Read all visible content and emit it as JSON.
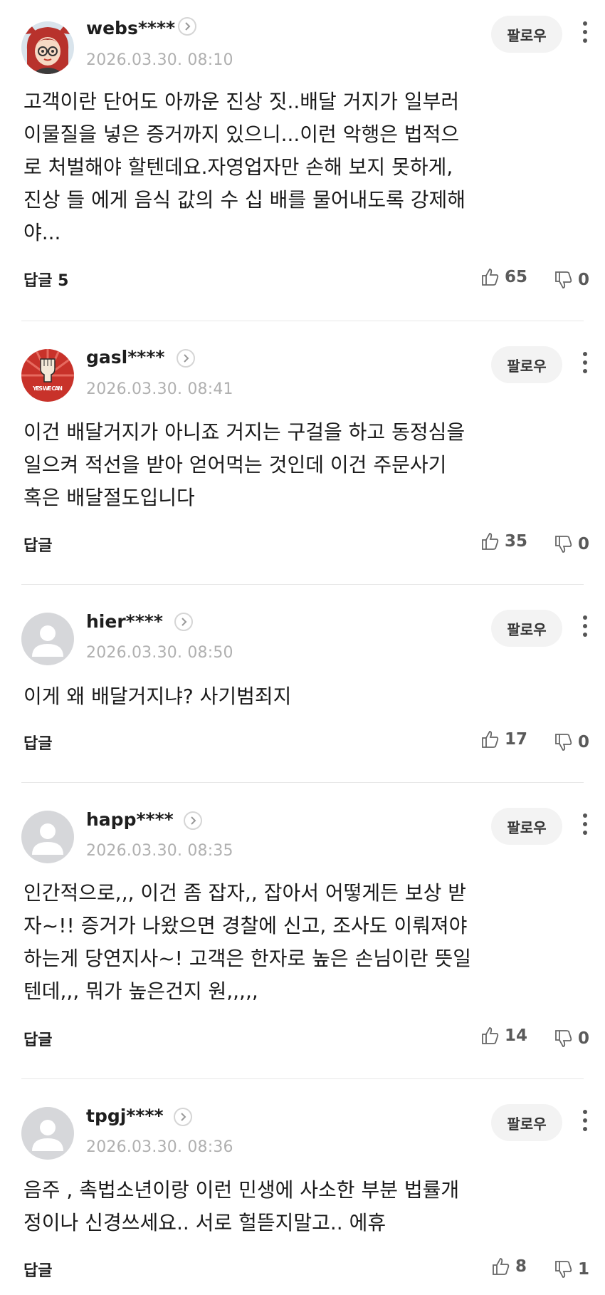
{
  "comments": [
    {
      "username": "webs****",
      "date": "2026.03.30. 08:10",
      "follow": "팔로우",
      "text": "고객이란 단어도 아까운 진상 짓..배달 거지가 일부러\n이물질을 넣은 증거까지 있으니...이런 악행은 법적으\n로 처벌해야 할텐데요.자영업자만 손해 보지 못하게,\n진상 들 에게 음식 값의 수 십 배를 물어내도록 강제해\n야...",
      "reply": "답글 5",
      "likes": "65",
      "dislikes": "0",
      "avatar": "character-icon"
    },
    {
      "username": "gasl****",
      "date": "2026.03.30. 08:41",
      "follow": "팔로우",
      "text": "이건 배달거지가 아니죠 거지는 구걸을 하고 동정심을\n일으켜 적선을 받아 얻어먹는 것인데 이건 주문사기\n혹은 배달절도입니다",
      "reply": "답글",
      "likes": "35",
      "dislikes": "0",
      "avatar": "fist-icon",
      "avatar_text": "YES WE CAN"
    },
    {
      "username": "hier****",
      "date": "2026.03.30. 08:50",
      "follow": "팔로우",
      "text": "이게 왜 배달거지냐? 사기범죄지",
      "reply": "답글",
      "likes": "17",
      "dislikes": "0",
      "avatar": "default-user-icon"
    },
    {
      "username": "happ****",
      "date": "2026.03.30. 08:35",
      "follow": "팔로우",
      "text": "인간적으로,,, 이건 좀 잡자,, 잡아서 어떻게든 보상 받\n자~!! 증거가 나왔으면 경찰에 신고, 조사도 이뤄져야\n하는게 당연지사~! 고객은 한자로 높은 손님이란 뜻일\n텐데,,, 뭐가 높은건지 원,,,,,",
      "reply": "답글",
      "likes": "14",
      "dislikes": "0",
      "avatar": "default-user-icon"
    },
    {
      "username": "tpgj****",
      "date": "2026.03.30. 08:36",
      "follow": "팔로우",
      "text": "음주 , 촉법소년이랑 이런 민생에 사소한 부분 법률개\n정이나 신경쓰세요.. 서로 헐뜯지말고.. 에휴",
      "reply": "답글",
      "likes": "8",
      "dislikes": "1",
      "avatar": "default-user-icon"
    }
  ]
}
